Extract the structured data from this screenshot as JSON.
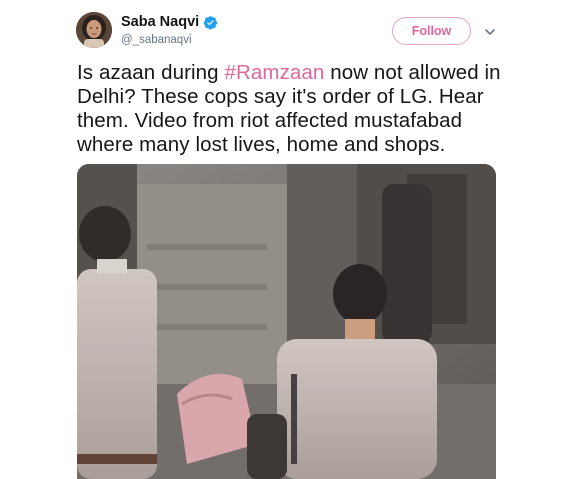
{
  "author": {
    "name": "Saba Naqvi",
    "handle": "@_sabanaqvi",
    "verified": true,
    "avatar_icon": "profile-photo"
  },
  "actions": {
    "follow_label": "Follow",
    "menu_icon": "chevron-down-icon"
  },
  "tweet": {
    "line1_before": "Is azaan during ",
    "hashtag": "#Ramzaan",
    "line1_after": " now not allowed in",
    "line2": "Delhi? These cops say it's order of LG. Hear",
    "line3": "them. Video from riot affected mustafabad",
    "line4": "where many lost lives, home and shops."
  },
  "media": {
    "type": "video-still",
    "description_icon": "video-thumbnail"
  },
  "colors": {
    "accent": "#e0669c",
    "follow_border": "#e7a6c7",
    "verified": "#1da1f2",
    "text": "#14171a",
    "muted": "#657786"
  }
}
